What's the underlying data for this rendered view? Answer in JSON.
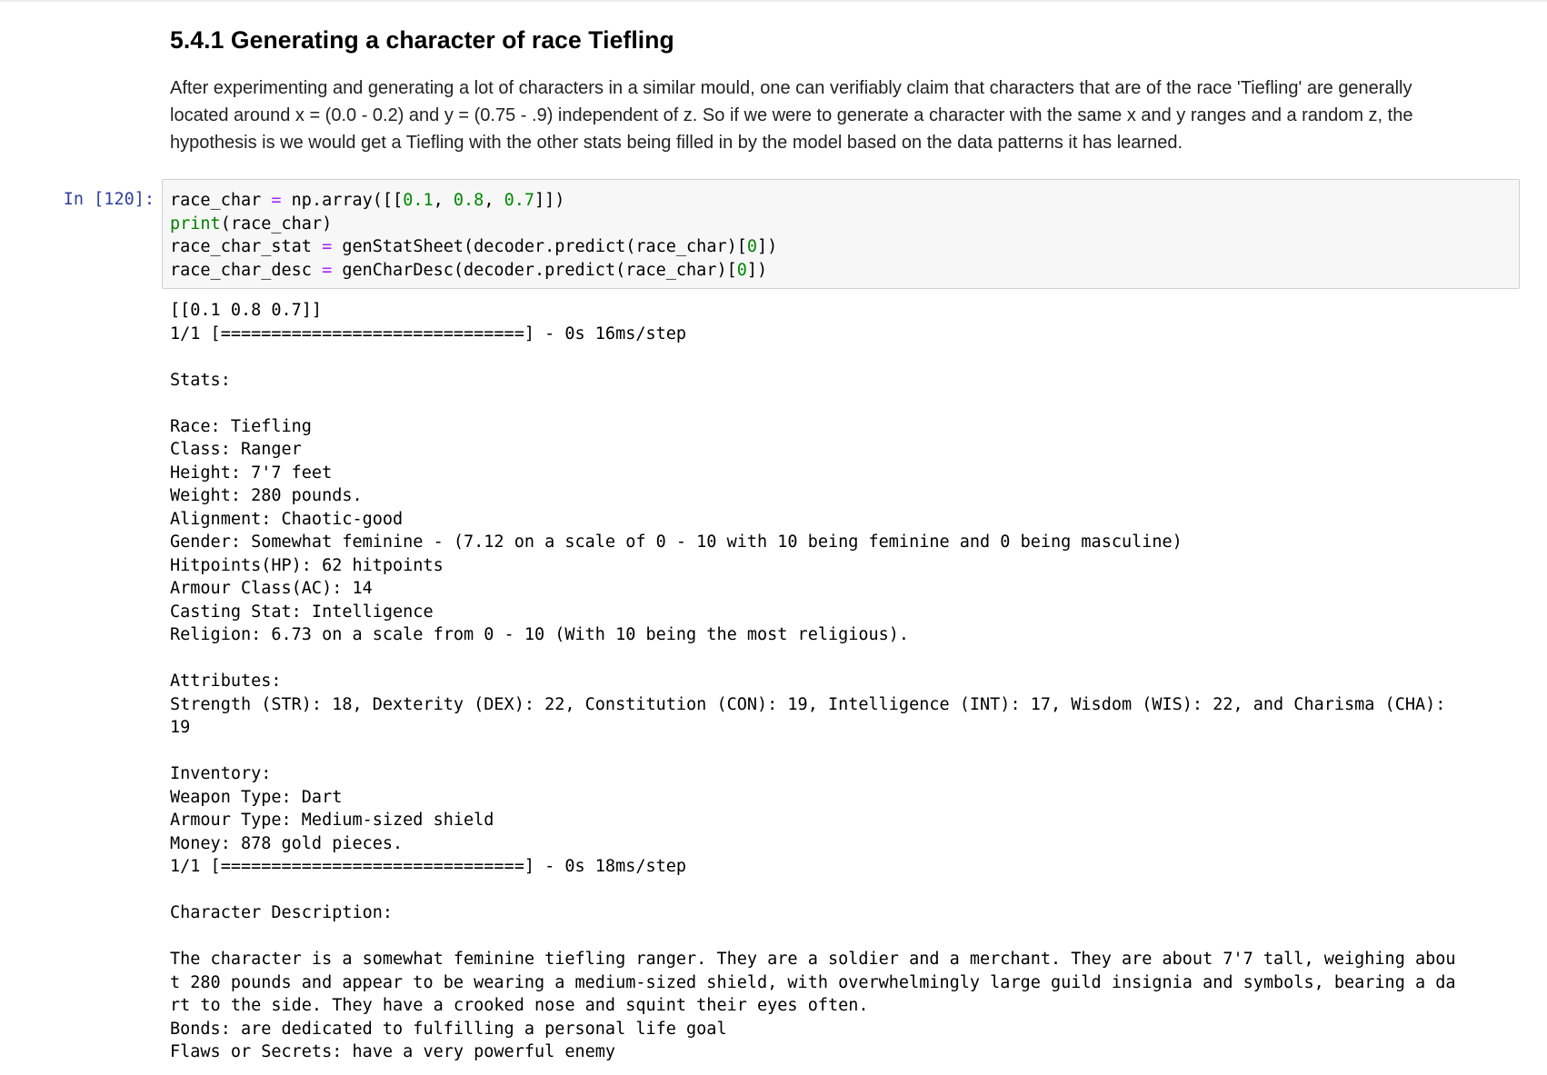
{
  "markdown": {
    "heading": "5.4.1 Generating a character of race Tiefling",
    "paragraph_lines": [
      "After experimenting and generating a lot of characters in a similar mould, one can verifiably claim that characters that are of the race 'Tiefling' are generally",
      "located around x = (0.0 - 0.2) and y = (0.75 - .9) independent of z. So if we were to generate a character with the same x and y ranges and a random z, the",
      "hypothesis is we would get a Tiefling with the other stats being filled in by the model based on the data patterns it has learned."
    ]
  },
  "code_cell": {
    "prompt": "In [120]:",
    "lines": [
      "race_char = np.array([[0.1, 0.8, 0.7]])",
      "print(race_char)",
      "race_char_stat = genStatSheet(decoder.predict(race_char)[0])",
      "race_char_desc = genCharDesc(decoder.predict(race_char)[0])"
    ],
    "tokens": {
      "var_race_char": "race_char",
      "eq": "=",
      "np_array_open": " np.array([[",
      "n1": "0.1",
      "comma": ", ",
      "n2": "0.8",
      "n3": "0.7",
      "close_2": "]])",
      "print_kw": "print",
      "print_arg": "(race_char)",
      "var_stat": "race_char_stat",
      "gen_stat": " genStatSheet(decoder.predict(race_char)[",
      "zero": "0",
      "close_1": "])",
      "var_desc": "race_char_desc",
      "gen_desc": " genCharDesc(decoder.predict(race_char)["
    }
  },
  "output": {
    "lines": [
      "[[0.1 0.8 0.7]]",
      "1/1 [==============================] - 0s 16ms/step",
      "",
      "Stats:",
      "",
      "Race: Tiefling",
      "Class: Ranger",
      "Height: 7'7 feet",
      "Weight: 280 pounds.",
      "Alignment: Chaotic-good",
      "Gender: Somewhat feminine - (7.12 on a scale of 0 - 10 with 10 being feminine and 0 being masculine)",
      "Hitpoints(HP): 62 hitpoints",
      "Armour Class(AC): 14",
      "Casting Stat: Intelligence",
      "Religion: 6.73 on a scale from 0 - 10 (With 10 being the most religious).",
      "",
      "Attributes:",
      "Strength (STR): 18, Dexterity (DEX): 22, Constitution (CON): 19, Intelligence (INT): 17, Wisdom (WIS): 22, and Charisma (CHA):",
      "19",
      "",
      "Inventory:",
      "Weapon Type: Dart",
      "Armour Type: Medium-sized shield",
      "Money: 878 gold pieces.",
      "1/1 [==============================] - 0s 18ms/step",
      "",
      "Character Description:",
      "",
      "The character is a somewhat feminine tiefling ranger. They are a soldier and a merchant. They are about 7'7 tall, weighing abou",
      "t 280 pounds and appear to be wearing a medium-sized shield, with overwhelmingly large guild insignia and symbols, bearing a da",
      "rt to the side. They have a crooked nose and squint their eyes often.",
      "Bonds: are dedicated to fulfilling a personal life goal",
      "Flaws or Secrets: have a very powerful enemy"
    ]
  }
}
